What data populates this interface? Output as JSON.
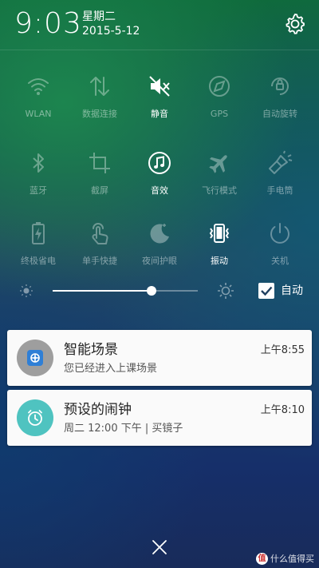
{
  "status": {
    "time": "9:03",
    "weekday": "星期二",
    "date": "2015-5-12"
  },
  "toggles": [
    {
      "label": "WLAN",
      "icon": "wifi-icon",
      "on": false
    },
    {
      "label": "数据连接",
      "icon": "data-arrows-icon",
      "on": false
    },
    {
      "label": "静音",
      "icon": "mute-icon",
      "on": true
    },
    {
      "label": "GPS",
      "icon": "gps-icon",
      "on": false
    },
    {
      "label": "自动旋转",
      "icon": "rotate-icon",
      "on": false
    },
    {
      "label": "蓝牙",
      "icon": "bluetooth-icon",
      "on": false
    },
    {
      "label": "截屏",
      "icon": "crop-icon",
      "on": false
    },
    {
      "label": "音效",
      "icon": "music-note-icon",
      "on": true
    },
    {
      "label": "飞行模式",
      "icon": "airplane-icon",
      "on": false
    },
    {
      "label": "手电筒",
      "icon": "flashlight-icon",
      "on": false
    },
    {
      "label": "终极省电",
      "icon": "battery-icon",
      "on": false
    },
    {
      "label": "单手快捷",
      "icon": "hand-tap-icon",
      "on": false
    },
    {
      "label": "夜间护眼",
      "icon": "moon-icon",
      "on": false
    },
    {
      "label": "振动",
      "icon": "vibrate-icon",
      "on": true
    },
    {
      "label": "关机",
      "icon": "power-icon",
      "on": false
    }
  ],
  "brightness": {
    "level": 0.68,
    "auto_label": "自动",
    "auto_checked": true
  },
  "notifications": [
    {
      "title": "智能场景",
      "text": "您已经进入上课场景",
      "time": "上午8:55",
      "icon": "smart-scene-icon",
      "accent": "#9e9e9e"
    },
    {
      "title": "预设的闹钟",
      "text": "周二 12:00 下午 | 买镜子",
      "time": "上午8:10",
      "icon": "alarm-clock-icon",
      "accent": "#4fc3c0"
    }
  ],
  "watermark": "什么值得买",
  "watermark_logo": "值"
}
